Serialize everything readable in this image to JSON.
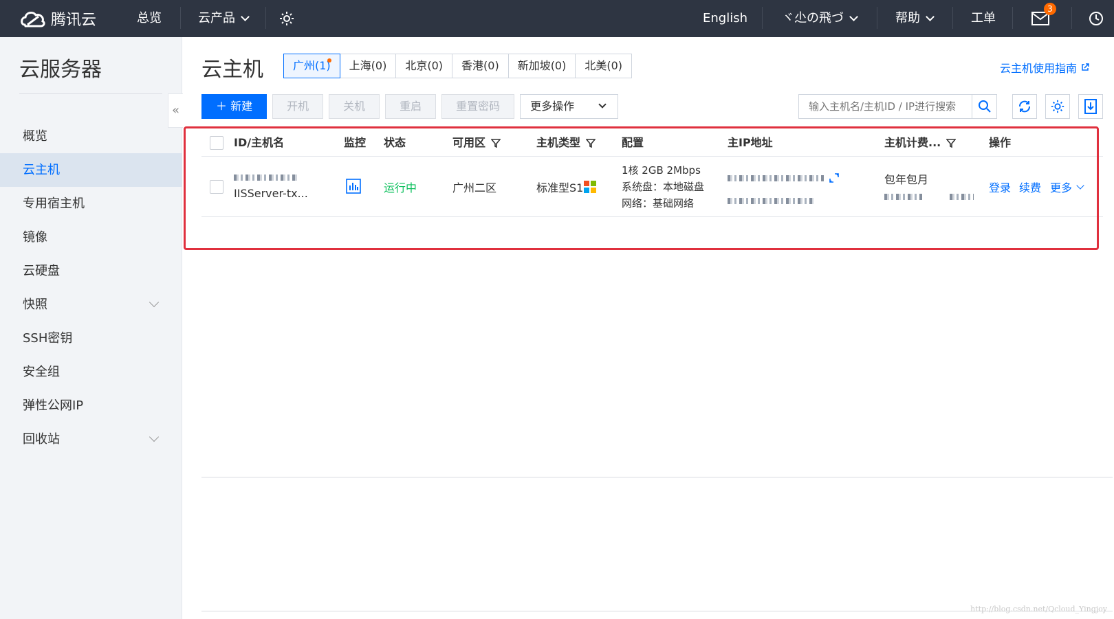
{
  "topbar": {
    "brand": "腾讯云",
    "nav_overview": "总览",
    "nav_products": "云产品",
    "nav_english": "English",
    "nav_user": "ヾ尐の飛づ",
    "nav_help": "帮助",
    "nav_ticket": "工单",
    "mail_badge": "3"
  },
  "sidebar": {
    "title": "云服务器",
    "items": [
      {
        "label": "概览"
      },
      {
        "label": "云主机"
      },
      {
        "label": "专用宿主机"
      },
      {
        "label": "镜像"
      },
      {
        "label": "云硬盘"
      },
      {
        "label": "快照"
      },
      {
        "label": "SSH密钥"
      },
      {
        "label": "安全组"
      },
      {
        "label": "弹性公网IP"
      },
      {
        "label": "回收站"
      }
    ],
    "collapse_glyph": "«"
  },
  "main": {
    "title": "云主机",
    "regions": [
      {
        "label": "广州(1)"
      },
      {
        "label": "上海(0)"
      },
      {
        "label": "北京(0)"
      },
      {
        "label": "香港(0)"
      },
      {
        "label": "新加坡(0)"
      },
      {
        "label": "北美(0)"
      }
    ],
    "guide_link": "云主机使用指南",
    "toolbar": {
      "new_label": "＋ 新建",
      "start_label": "开机",
      "stop_label": "关机",
      "restart_label": "重启",
      "reset_pwd_label": "重置密码",
      "more_ops_label": "更多操作"
    },
    "search_placeholder": "输入主机名/主机ID / IP进行搜索"
  },
  "table": {
    "headers": {
      "id_name": "ID/主机名",
      "monitor": "监控",
      "status": "状态",
      "zone": "可用区",
      "type": "主机类型",
      "config": "配置",
      "ip": "主IP地址",
      "billing": "主机计费...",
      "ops": "操作"
    },
    "rows": [
      {
        "name": "IISServer-tx...",
        "status": "运行中",
        "zone": "广州二区",
        "type": "标准型S1",
        "config_line1": "1核 2GB 2Mbps",
        "config_line2": "系统盘：本地磁盘",
        "config_line3": "网络：基础网络",
        "billing": "包年包月",
        "op_login": "登录",
        "op_renew": "续费",
        "op_more": "更多"
      }
    ]
  },
  "watermark": "http://blog.csdn.net/Qcloud_Yingjoy",
  "colors": {
    "topbar": "#2e3542",
    "accent": "#006eff",
    "status_running": "#0abf5b",
    "highlight": "#e0303e"
  }
}
